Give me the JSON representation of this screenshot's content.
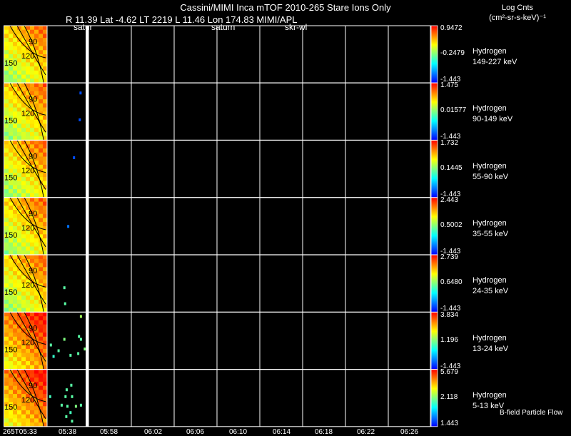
{
  "header": {
    "title": "Cassini/MIMI Inca mTOF  2010-265   Stare    Ions Only",
    "ephemeris": "R        11.39 Lat -4.62 LT 2219 L        11.46 Lon          174.83  MIMI/APL"
  },
  "units": {
    "line1": "Log Cnts",
    "line2": "(cm²-sr-s-keV)⁻¹"
  },
  "markers": [
    "satur",
    "saturn",
    "skr-wl"
  ],
  "time_axis": {
    "ticks": [
      "265T05:33",
      "05:38",
      "05:58",
      "06:02",
      "06:06",
      "06:10",
      "06:14",
      "06:18",
      "06:22",
      "06:26"
    ]
  },
  "footer_note": "B-field Particle Flow",
  "colors": {
    "background": "#000000",
    "axes": "#ffffff",
    "contours": "#000000",
    "colorbar": [
      "#0000ff",
      "#00ffff",
      "#ffff00",
      "#ff0000"
    ]
  },
  "chart_data": {
    "type": "heatmap",
    "x_unit": "UT time",
    "contour_labels": [
      "90",
      "120",
      "150"
    ],
    "panels": [
      {
        "species": "Hydrogen",
        "energy": "149-227 keV",
        "cb_max": "0.9472",
        "cb_mid": "-0.2479",
        "cb_min": "-1.443",
        "points": []
      },
      {
        "species": "Hydrogen",
        "energy": "90-149 keV",
        "cb_max": "1.475",
        "cb_mid": "0.01577",
        "cb_min": "-1.443",
        "points": [
          [
            0.84,
            0.15,
            0.1
          ],
          [
            0.82,
            0.62,
            0.1
          ]
        ]
      },
      {
        "species": "Hydrogen",
        "energy": "55-90 keV",
        "cb_max": "1.732",
        "cb_mid": "0.1445",
        "cb_min": "-1.443",
        "points": [
          [
            0.67,
            0.28,
            0.1
          ]
        ]
      },
      {
        "species": "Hydrogen",
        "energy": "35-55 keV",
        "cb_max": "2.443",
        "cb_mid": "0.5002",
        "cb_min": "-1.443",
        "points": [
          [
            0.52,
            0.48,
            0.15
          ]
        ]
      },
      {
        "species": "Hydrogen",
        "energy": "24-35 keV",
        "cb_max": "2.739",
        "cb_mid": "0.6480",
        "cb_min": "-1.443",
        "points": [
          [
            0.42,
            0.55,
            0.45
          ],
          [
            0.44,
            0.83,
            0.45
          ]
        ]
      },
      {
        "species": "Hydrogen",
        "energy": "13-24 keV",
        "cb_max": "3.834",
        "cb_mid": "1.196",
        "cb_min": "-1.443",
        "points": [
          [
            0.85,
            0.05,
            0.55
          ],
          [
            0.8,
            0.4,
            0.45
          ],
          [
            0.42,
            0.45,
            0.5
          ],
          [
            0.07,
            0.55,
            0.45
          ],
          [
            0.85,
            0.45,
            0.45
          ],
          [
            0.27,
            0.65,
            0.45
          ],
          [
            0.58,
            0.73,
            0.45
          ],
          [
            0.78,
            0.7,
            0.45
          ],
          [
            0.95,
            0.62,
            0.5
          ],
          [
            0.14,
            0.75,
            0.4
          ]
        ]
      },
      {
        "species": "Hydrogen",
        "energy": "5-13 keV",
        "cb_max": "5.679",
        "cb_mid": "2.118",
        "cb_min": "1.443",
        "points": [
          [
            0.6,
            0.25,
            0.45
          ],
          [
            0.48,
            0.33,
            0.45
          ],
          [
            0.45,
            0.45,
            0.45
          ],
          [
            0.62,
            0.45,
            0.45
          ],
          [
            0.05,
            0.45,
            0.42
          ],
          [
            0.35,
            0.6,
            0.45
          ],
          [
            0.5,
            0.62,
            0.45
          ],
          [
            0.72,
            0.62,
            0.5
          ],
          [
            0.58,
            0.73,
            0.42
          ],
          [
            0.47,
            0.8,
            0.45
          ],
          [
            0.62,
            0.88,
            0.45
          ],
          [
            0.85,
            0.6,
            0.45
          ]
        ]
      }
    ]
  }
}
